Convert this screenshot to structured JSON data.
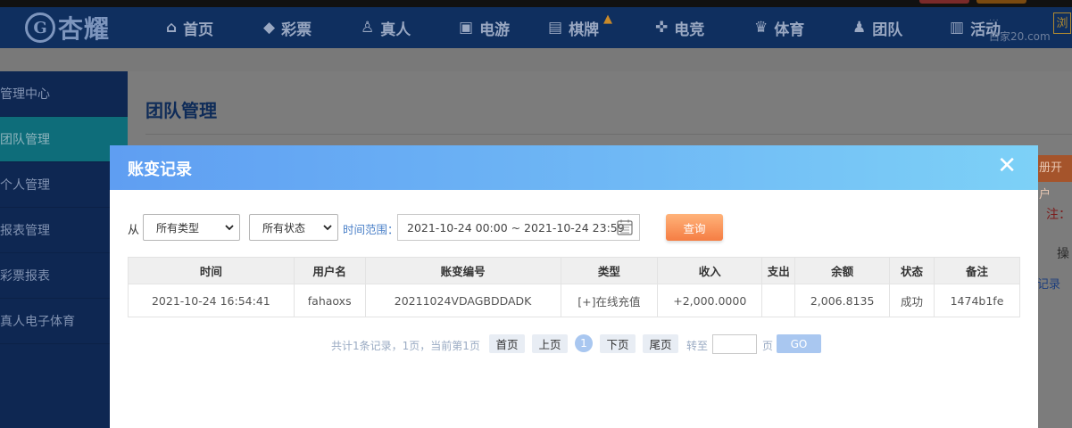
{
  "site": {
    "logo_mark": "G",
    "logo_text": "杏耀",
    "watermark_small": "...",
    "watermark_big": "白家20.com",
    "watermark_box": "浏"
  },
  "nav": {
    "items": [
      {
        "label": "首页",
        "icon": "home-icon",
        "glyph": "⌂"
      },
      {
        "label": "彩票",
        "icon": "lottery-icon",
        "glyph": "◆"
      },
      {
        "label": "真人",
        "icon": "live-icon",
        "glyph": "♙"
      },
      {
        "label": "电游",
        "icon": "slot-icon",
        "glyph": "▣"
      },
      {
        "label": "棋牌",
        "icon": "cards-icon",
        "glyph": "▤"
      },
      {
        "label": "电竞",
        "icon": "gamepad-icon",
        "glyph": "✜"
      },
      {
        "label": "体育",
        "icon": "trophy-icon",
        "glyph": "♛"
      },
      {
        "label": "团队",
        "icon": "team-icon",
        "glyph": "♟"
      },
      {
        "label": "活动",
        "icon": "gift-icon",
        "glyph": "▥"
      }
    ],
    "hot_badge_glyph": "▲"
  },
  "sidebar": {
    "items": [
      {
        "label": "管理中心",
        "active": false
      },
      {
        "label": "团队管理",
        "active": true
      },
      {
        "label": "个人管理",
        "active": false
      },
      {
        "label": "报表管理",
        "active": false
      },
      {
        "label": "彩票报表",
        "active": false
      },
      {
        "label": "真人电子体育",
        "active": false
      }
    ]
  },
  "panel": {
    "title": "团队管理",
    "side_button": "册开户",
    "side_note": "注：",
    "side_op": "操",
    "side_record": "记录"
  },
  "modal": {
    "title": "账变记录",
    "close_glyph": "✕",
    "filter": {
      "from_label": "从",
      "type_value": "所有类型",
      "status_value": "所有状态",
      "range_label": "时间范围：",
      "date_range": "2021-10-24 00:00 ~ 2021-10-24 23:59",
      "query_label": "查询"
    },
    "table": {
      "headers": [
        "时间",
        "用户名",
        "账变编号",
        "类型",
        "收入",
        "支出",
        "余额",
        "状态",
        "备注"
      ],
      "rows": [
        [
          "2021-10-24 16:54:41",
          "fahaoxs",
          "20211024VDAGBDDADK",
          "[+]在线充值",
          "+2,000.0000",
          "",
          "2,006.8135",
          "成功",
          "1474b1fe"
        ]
      ]
    },
    "pager": {
      "summary": "共计1条记录，1页，当前第1页",
      "first": "首页",
      "prev": "上页",
      "current": "1",
      "next": "下页",
      "last": "尾页",
      "goto_label": "转至",
      "page_unit": "页",
      "go_label": "GO"
    }
  },
  "colors": {
    "header_gradient_start": "#5f9ef2",
    "header_gradient_end": "#7dd1f7",
    "query_button": "#f57d43",
    "income_text": "#6b9b1e"
  }
}
